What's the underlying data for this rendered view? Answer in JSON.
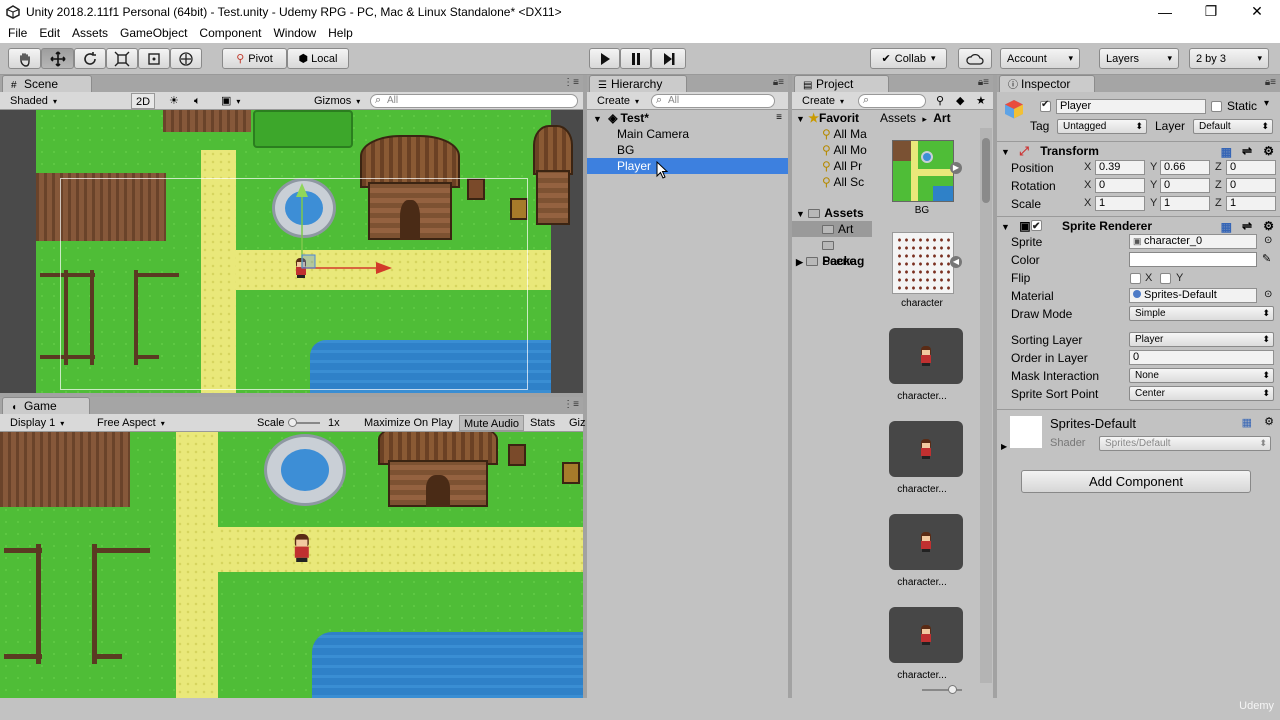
{
  "window": {
    "title": "Unity 2018.2.11f1 Personal (64bit) - Test.unity - Udemy RPG - PC, Mac & Linux Standalone* <DX11>",
    "minimize": "—",
    "restore": "❐",
    "close": "✕"
  },
  "menu": [
    "File",
    "Edit",
    "Assets",
    "GameObject",
    "Component",
    "Window",
    "Help"
  ],
  "toolbar": {
    "pivot": "Pivot",
    "local": "Local",
    "collab": "Collab",
    "account": "Account",
    "layers": "Layers",
    "layout": "2 by 3"
  },
  "scene": {
    "tab": "Scene",
    "shading": "Shaded",
    "mode2d": "2D",
    "gizmos": "Gizmos",
    "search_placeholder": "All"
  },
  "game": {
    "tab": "Game",
    "display": "Display 1",
    "aspect": "Free Aspect",
    "scale_label": "Scale",
    "scale_value": "1x",
    "maximize": "Maximize On Play",
    "mute": "Mute Audio",
    "stats": "Stats",
    "gizmos": "Giz"
  },
  "hierarchy": {
    "tab": "Hierarchy",
    "create": "Create",
    "search_placeholder": "All",
    "scene_name": "Test*",
    "items": [
      "Main Camera",
      "BG",
      "Player"
    ],
    "selected": "Player"
  },
  "project": {
    "tab": "Project",
    "create": "Create",
    "favorites_label": "Favorit",
    "favorites": [
      "All Ma",
      "All Mo",
      "All Pr",
      "All Sc"
    ],
    "assets_label": "Assets",
    "asset_folders": [
      "Art",
      "Scene"
    ],
    "packages_label": "Packag",
    "breadcrumb_root": "Assets",
    "breadcrumb_sep": "▸",
    "breadcrumb_current": "Art",
    "thumbs": [
      "BG",
      "character",
      "character...",
      "character...",
      "character...",
      "character..."
    ]
  },
  "inspector": {
    "tab": "Inspector",
    "object_name": "Player",
    "static_label": "Static",
    "tag_label": "Tag",
    "tag_value": "Untagged",
    "layer_label": "Layer",
    "layer_value": "Default",
    "transform": {
      "title": "Transform",
      "position_label": "Position",
      "rotation_label": "Rotation",
      "scale_label": "Scale",
      "position": [
        "0.39",
        "0.66",
        "0"
      ],
      "rotation": [
        "0",
        "0",
        "0"
      ],
      "scale": [
        "1",
        "1",
        "1"
      ],
      "axes": [
        "X",
        "Y",
        "Z"
      ]
    },
    "sprite_renderer": {
      "title": "Sprite Renderer",
      "sprite_label": "Sprite",
      "sprite_value": "character_0",
      "color_label": "Color",
      "flip_label": "Flip",
      "flip_x": "X",
      "flip_y": "Y",
      "material_label": "Material",
      "material_value": "Sprites-Default",
      "draw_mode_label": "Draw Mode",
      "draw_mode_value": "Simple",
      "sorting_layer_label": "Sorting Layer",
      "sorting_layer_value": "Player",
      "order_label": "Order in Layer",
      "order_value": "0",
      "mask_label": "Mask Interaction",
      "mask_value": "None",
      "sort_point_label": "Sprite Sort Point",
      "sort_point_value": "Center"
    },
    "material": {
      "name": "Sprites-Default",
      "shader_label": "Shader",
      "shader_value": "Sprites/Default"
    },
    "add_component": "Add Component"
  },
  "watermark": "Udemy"
}
